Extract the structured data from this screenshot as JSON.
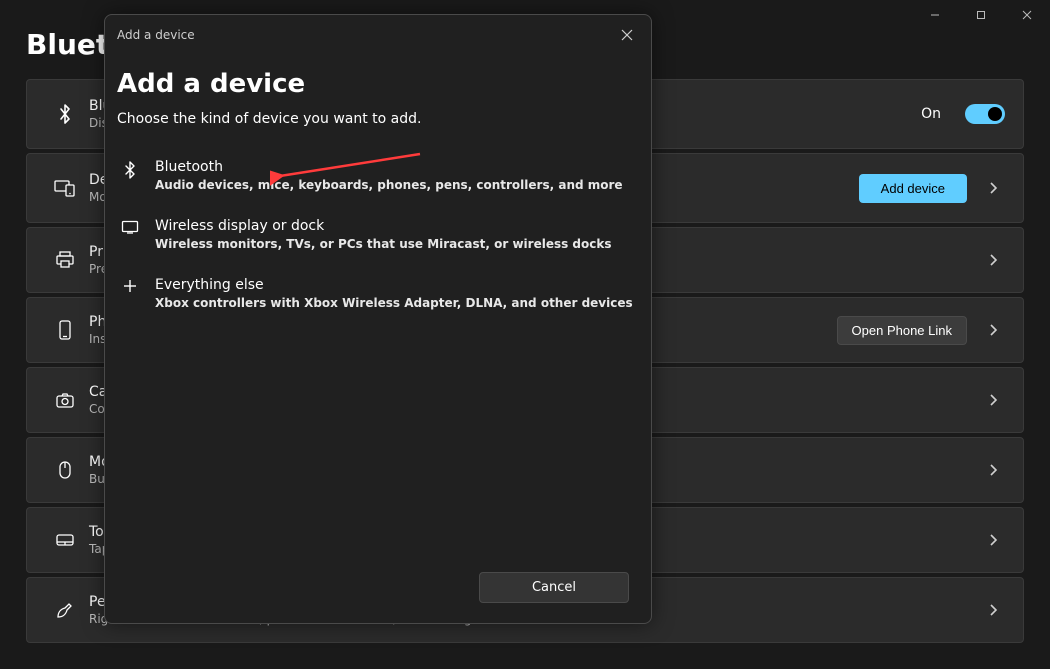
{
  "window": {
    "page_title": "Bluetooth & devices"
  },
  "cards": {
    "bluetooth": {
      "title": "Bluetooth",
      "sub": "Discoverable as",
      "toggle_label": "On"
    },
    "devices": {
      "title": "Devices",
      "sub": "Mouse, keyboard, pen, audio, displays and docks, other devices",
      "button": "Add device"
    },
    "printers": {
      "title": "Printers & scanners",
      "sub": "Preferences, troubleshoot"
    },
    "phone": {
      "title": "Phone Link",
      "sub": "Instantly access your Android device's photos, texts, and more",
      "button": "Open Phone Link"
    },
    "cameras": {
      "title": "Cameras",
      "sub": "Connected cameras, default image settings"
    },
    "mouse": {
      "title": "Mouse",
      "sub": "Buttons, mouse pointer speed, scrolling"
    },
    "touchpad": {
      "title": "Touchpad",
      "sub": "Taps, gestures, scrolling, zooming"
    },
    "pen": {
      "title": "Pen & Windows Ink",
      "sub": "Right-handed or left-handed, pen button shortcuts, handwriting"
    }
  },
  "dialog": {
    "header": "Add a device",
    "title": "Add a device",
    "subtitle": "Choose the kind of device you want to add.",
    "options": {
      "bluetooth": {
        "title": "Bluetooth",
        "desc": "Audio devices, mice, keyboards, phones, pens, controllers, and more"
      },
      "wireless": {
        "title": "Wireless display or dock",
        "desc": "Wireless monitors, TVs, or PCs that use Miracast, or wireless docks"
      },
      "other": {
        "title": "Everything else",
        "desc": "Xbox controllers with Xbox Wireless Adapter, DLNA, and other devices"
      }
    },
    "cancel": "Cancel"
  }
}
